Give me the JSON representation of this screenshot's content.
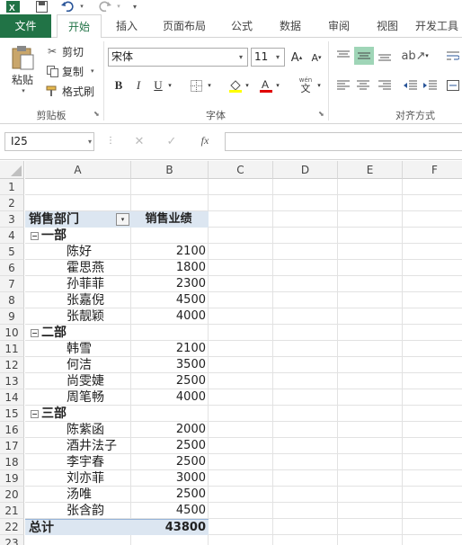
{
  "quick_access": {
    "excel_icon": "excel-logo-icon",
    "save_icon": "save-icon",
    "undo_icon": "undo-icon",
    "redo_icon": "redo-icon",
    "customize_icon": "customize-qat-icon"
  },
  "tabs": [
    "文件",
    "开始",
    "插入",
    "页面布局",
    "公式",
    "数据",
    "审阅",
    "视图",
    "开发工具"
  ],
  "active_tab": "开始",
  "clipboard": {
    "paste": "粘贴",
    "cut": "剪切",
    "copy": "复制",
    "format_painter": "格式刷",
    "group": "剪贴板"
  },
  "font": {
    "name": "宋体",
    "size": "11",
    "grow": "A",
    "shrink": "A",
    "bold": "B",
    "italic": "I",
    "underline": "U",
    "wen": "wén",
    "wen_char": "文",
    "group": "字体",
    "color_fill": "#ffff00",
    "color_font": "#e00000"
  },
  "alignment": {
    "group": "对齐方式"
  },
  "formula_bar": {
    "cell_ref": "I25",
    "cancel": "✕",
    "enter": "✓",
    "fx": "fx",
    "value": ""
  },
  "columns": [
    "A",
    "B",
    "C",
    "D",
    "E",
    "F"
  ],
  "rows": [
    "1",
    "2",
    "3",
    "4",
    "5",
    "6",
    "7",
    "8",
    "9",
    "10",
    "11",
    "12",
    "13",
    "14",
    "15",
    "16",
    "17",
    "18",
    "19",
    "20",
    "21",
    "22",
    "23"
  ],
  "pivot": {
    "header_a": "销售部门",
    "header_b": "销售业绩",
    "groups": [
      {
        "name": "一部",
        "items": [
          {
            "name": "陈好",
            "value": "2100"
          },
          {
            "name": "霍思燕",
            "value": "1800"
          },
          {
            "name": "孙菲菲",
            "value": "2300"
          },
          {
            "name": "张嘉倪",
            "value": "4500"
          },
          {
            "name": "张靓颖",
            "value": "4000"
          }
        ]
      },
      {
        "name": "二部",
        "items": [
          {
            "name": "韩雪",
            "value": "2100"
          },
          {
            "name": "何洁",
            "value": "3500"
          },
          {
            "name": "尚雯婕",
            "value": "2500"
          },
          {
            "name": "周笔畅",
            "value": "4000"
          }
        ]
      },
      {
        "name": "三部",
        "items": [
          {
            "name": "陈紫函",
            "value": "2000"
          },
          {
            "name": "酒井法子",
            "value": "2500"
          },
          {
            "name": "李宇春",
            "value": "2500"
          },
          {
            "name": "刘亦菲",
            "value": "3000"
          },
          {
            "name": "汤唯",
            "value": "2500"
          },
          {
            "name": "张含韵",
            "value": "4500"
          }
        ]
      }
    ],
    "total_label": "总计",
    "total_value": "43800"
  }
}
